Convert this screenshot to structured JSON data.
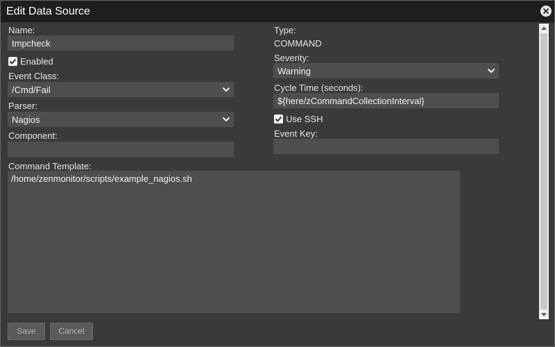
{
  "dialog": {
    "title": "Edit Data Source"
  },
  "form": {
    "name": {
      "label": "Name:",
      "value": "tmpcheck"
    },
    "enabled": {
      "label": "Enabled",
      "checked": true
    },
    "event_class": {
      "label": "Event Class:",
      "value": "/Cmd/Fail"
    },
    "parser": {
      "label": "Parser:",
      "value": "Nagios"
    },
    "component": {
      "label": "Component:",
      "value": ""
    },
    "type": {
      "label": "Type:",
      "value": "COMMAND"
    },
    "severity": {
      "label": "Severity:",
      "value": "Warning"
    },
    "cycle_time": {
      "label": "Cycle Time (seconds):",
      "value": "${here/zCommandCollectionInterval}"
    },
    "use_ssh": {
      "label": "Use SSH",
      "checked": true
    },
    "event_key": {
      "label": "Event Key:",
      "value": ""
    },
    "command_template": {
      "label": "Command Template:",
      "value": "/home/zenmonitor/scripts/example_nagios.sh"
    }
  },
  "buttons": {
    "save": "Save",
    "cancel": "Cancel"
  },
  "colors": {
    "titlebar": "#1e1e1e",
    "background": "#3a3a3a",
    "field": "#4e4e4e",
    "text": "#e6e6e6"
  }
}
